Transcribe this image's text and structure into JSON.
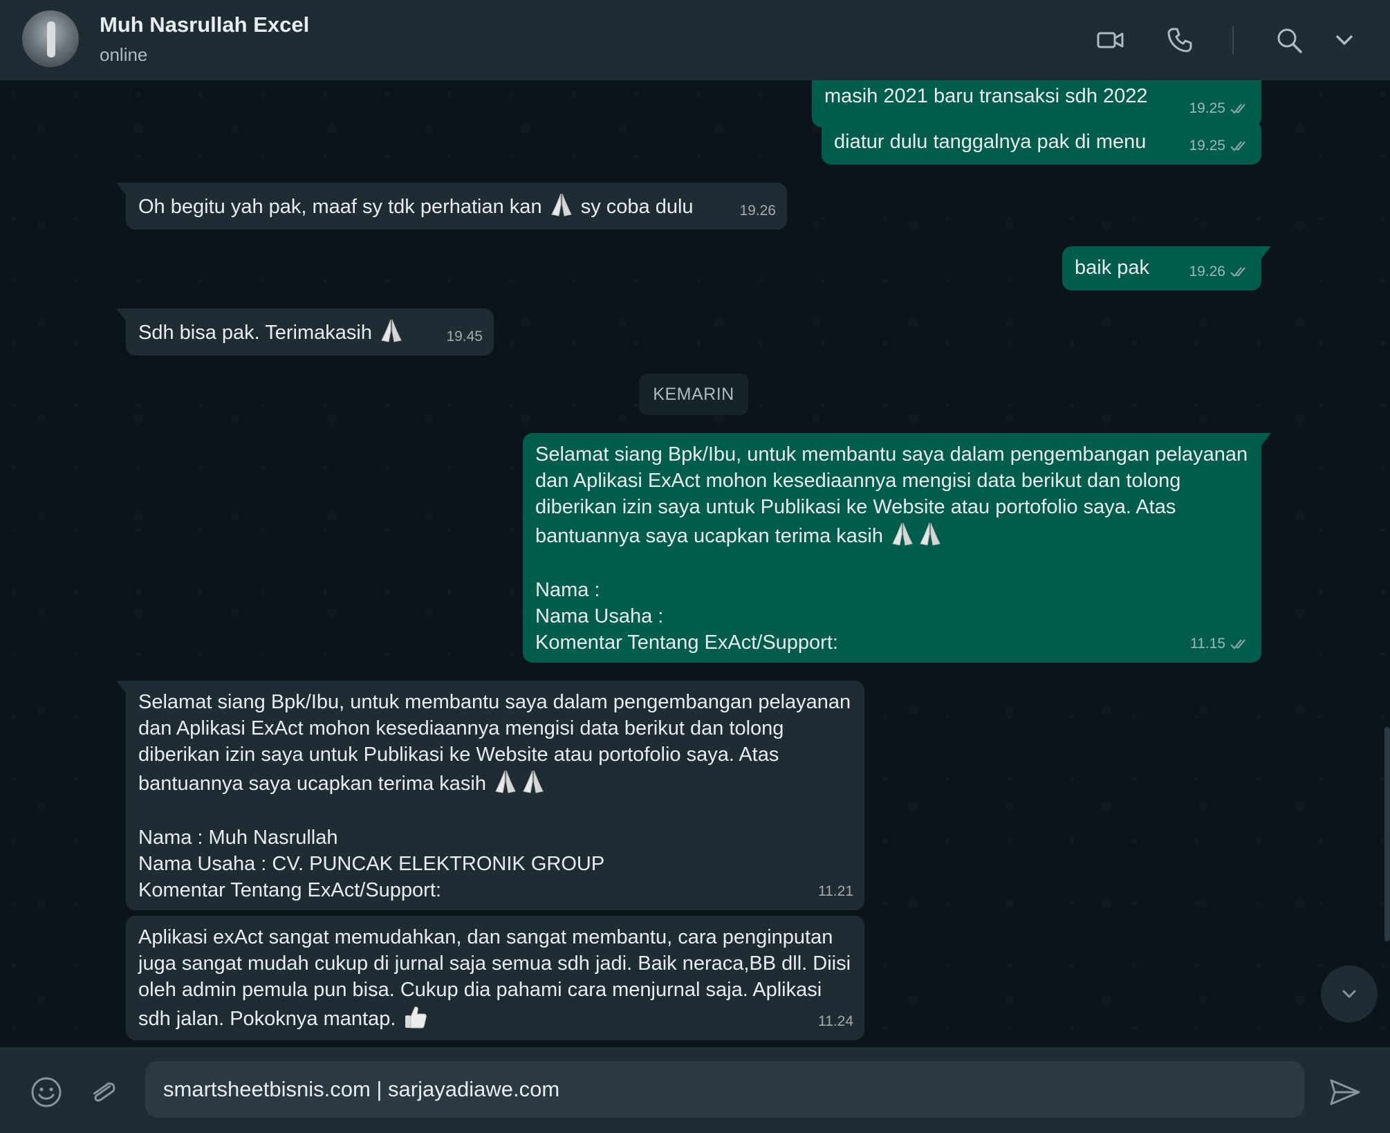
{
  "header": {
    "contact_name": "Muh Nasrullah Excel",
    "status": "online",
    "icons": [
      "video-call-icon",
      "voice-call-icon",
      "search-icon",
      "chevron-down-icon"
    ]
  },
  "messages": [
    {
      "direction": "out",
      "text": "masih 2021 baru transaksi sdh 2022",
      "time": "19.25",
      "ticks": "double-check"
    },
    {
      "direction": "out",
      "text": "diatur dulu tanggalnya pak di menu",
      "time": "19.25",
      "ticks": "double-check"
    },
    {
      "direction": "in",
      "text_before": "Oh begitu yah pak, maaf sy tdk perhatian kan ",
      "emoji": "folded-hands",
      "text_after": " sy coba dulu",
      "time": "19.26"
    },
    {
      "direction": "out",
      "text": "baik pak",
      "time": "19.26",
      "ticks": "double-check"
    },
    {
      "direction": "in",
      "text_before": "Sdh bisa pak. Terimakasih ",
      "emoji": "folded-hands",
      "time": "19.45"
    },
    {
      "direction": "out",
      "text": "Selamat siang Bpk/Ibu, untuk membantu saya dalam pengembangan pelayanan dan Aplikasi ExAct mohon kesediaannya mengisi data berikut dan tolong diberikan izin saya untuk Publikasi ke Website atau portofolio saya. Atas bantuannya saya ucapkan terima kasih",
      "form_lines": [
        "Nama :",
        "Nama Usaha :",
        "Komentar Tentang ExAct/Support:"
      ],
      "time": "11.15",
      "ticks": "double-check"
    },
    {
      "direction": "in",
      "text": "Selamat siang Bpk/Ibu, untuk membantu saya dalam pengembangan pelayanan dan Aplikasi ExAct mohon kesediaannya mengisi data berikut dan tolong diberikan izin saya untuk Publikasi ke Website atau portofolio saya. Atas bantuannya saya ucapkan terima kasih",
      "form_lines": [
        "Nama : Muh Nasrullah",
        "Nama Usaha : CV. PUNCAK ELEKTRONIK GROUP",
        "Komentar Tentang ExAct/Support:"
      ],
      "time": "11.21"
    },
    {
      "direction": "in",
      "text": "Aplikasi exAct sangat memudahkan, dan sangat membantu, cara penginputan juga sangat mudah cukup di jurnal saja semua sdh jadi. Baik neraca,BB dll. Diisi oleh admin pemula pun bisa. Cukup dia pahami cara menjurnal saja. Aplikasi sdh jalan. Pokoknya mantap.",
      "emoji": "thumbs-up",
      "time": "11.24"
    }
  ],
  "date_divider": "KEMARIN",
  "composer": {
    "value": "smartsheetbisnis.com | sarjayadiawe.com",
    "icons": [
      "emoji-icon",
      "attach-icon",
      "send-icon"
    ]
  },
  "colors": {
    "header_bg": "#202c33",
    "chat_bg": "#0b141a",
    "outgoing_bubble": "#005c4b",
    "incoming_bubble": "#202c33",
    "read_ticks": "#8ba3a9"
  }
}
